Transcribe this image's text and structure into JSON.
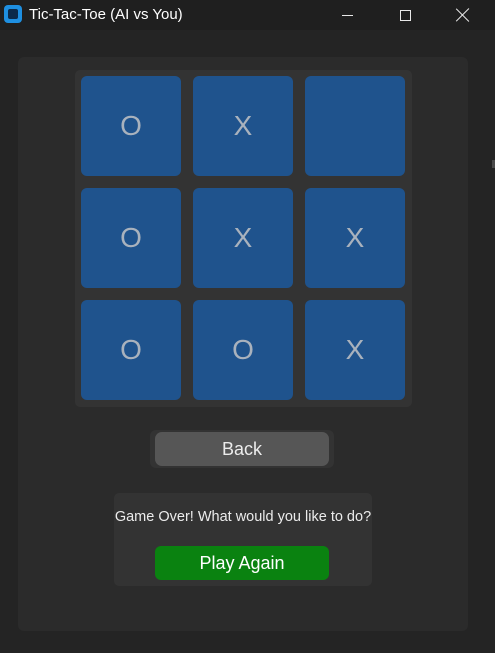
{
  "window": {
    "title": "Tic-Tac-Toe (AI vs You)",
    "controls": [
      "minimize",
      "maximize",
      "close"
    ]
  },
  "board": {
    "cells": [
      [
        "O",
        "X",
        ""
      ],
      [
        "O",
        "X",
        "X"
      ],
      [
        "O",
        "O",
        "X"
      ]
    ],
    "colors": {
      "cell": "#1f538d",
      "mark": "#a9b2bd"
    }
  },
  "buttons": {
    "back_label": "Back",
    "play_again_label": "Play Again"
  },
  "game_over": {
    "message": "Game Over! What would you like to do?"
  },
  "colors": {
    "play_again": "#0a8210",
    "back": "#565656",
    "background": "#242424"
  }
}
